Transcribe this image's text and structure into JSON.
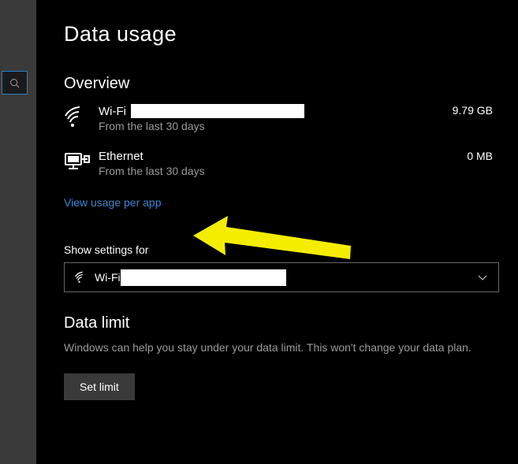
{
  "page": {
    "title": "Data usage"
  },
  "overview": {
    "title": "Overview",
    "items": [
      {
        "name": "Wi-Fi",
        "subtitle": "From the last 30 days",
        "usage": "9.79 GB",
        "icon": "wifi"
      },
      {
        "name": "Ethernet",
        "subtitle": "From the last 30 days",
        "usage": "0 MB",
        "icon": "ethernet"
      }
    ],
    "link_label": "View usage per app"
  },
  "show_settings": {
    "label": "Show settings for",
    "selected": "Wi-Fi"
  },
  "data_limit": {
    "title": "Data limit",
    "description": "Windows can help you stay under your data limit. This won't change your data plan.",
    "button": "Set limit"
  }
}
